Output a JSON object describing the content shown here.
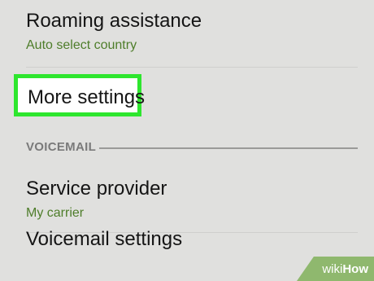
{
  "settings": {
    "roaming": {
      "title": "Roaming assistance",
      "subtitle": "Auto select country"
    },
    "more_settings": {
      "title": "More settings"
    },
    "voicemail_section": {
      "label": "VOICEMAIL"
    },
    "service_provider": {
      "title": "Service provider",
      "subtitle": "My carrier"
    },
    "voicemail_settings": {
      "title": "Voicemail settings"
    }
  },
  "watermark": {
    "part1": "wiki",
    "part2": "How"
  },
  "colors": {
    "background": "#e0e0de",
    "subtitle_green": "#4e7d2a",
    "highlight_green": "#2ee62e",
    "watermark_green": "#8fb86e"
  }
}
